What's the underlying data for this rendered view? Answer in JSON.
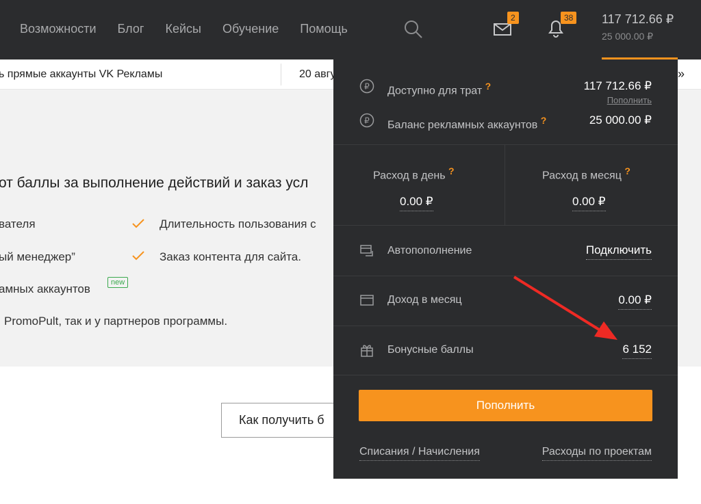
{
  "nav": [
    "Возможности",
    "Блог",
    "Кейсы",
    "Обучение",
    "Помощь"
  ],
  "header": {
    "mail_count": "2",
    "notif_count": "38",
    "balance": "117 712.66 ₽",
    "ad_balance": "25 000.00 ₽"
  },
  "ticker": {
    "left": "ь прямые аккаунты VK Рекламы",
    "right": "20 авгу",
    "arrow": "»"
  },
  "content": {
    "headline": "от баллы за выполнение действий и заказ усл",
    "items": [
      "вателя",
      "Длительность пользования с",
      "ый менеджер”",
      "Заказ контента для сайта.",
      "амных аккаунтов",
      "PromoPult, так и у партнеров программы."
    ],
    "new_badge": "new",
    "how_button": "Как получить б"
  },
  "dropdown": {
    "available_label": "Доступно для трат",
    "available_value": "117 712.66 ₽",
    "topup_link": "Пополнить",
    "ad_balance_label": "Баланс рекламных аккаунтов",
    "ad_balance_value": "25 000.00 ₽",
    "q": "?",
    "daily_label": "Расход в день",
    "daily_value": "0.00 ₽",
    "monthly_label": "Расход в месяц",
    "monthly_value": "0.00 ₽",
    "autopay_label": "Автопополнение",
    "autopay_action": "Подключить",
    "income_label": "Доход в месяц",
    "income_value": "0.00 ₽",
    "bonus_label": "Бонусные баллы",
    "bonus_value": "6 152",
    "pay_button": "Пополнить",
    "link_charges": "Списания / Начисления",
    "link_projects": "Расходы по проектам"
  },
  "colors": {
    "accent": "#f7931e",
    "dark_bg": "#2b2c2e",
    "arrow": "#ee2a24"
  }
}
